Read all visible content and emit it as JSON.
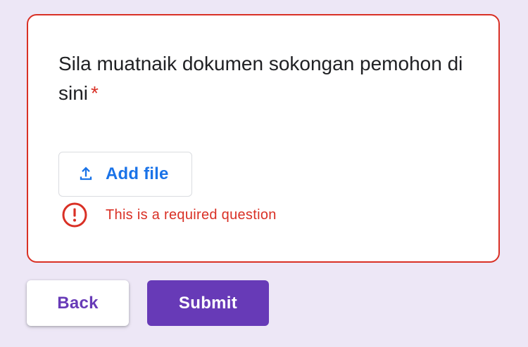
{
  "question": {
    "text": "Sila muatnaik dokumen sokongan pemohon di sini",
    "required_marker": "*"
  },
  "upload": {
    "label": "Add file",
    "icon": "upload-icon"
  },
  "error": {
    "message": "This is a required question",
    "icon": "error-icon"
  },
  "buttons": {
    "back_label": "Back",
    "submit_label": "Submit"
  },
  "colors": {
    "background": "#ede7f6",
    "accent": "#673ab7",
    "error": "#d93025",
    "link_blue": "#1a73e8"
  }
}
